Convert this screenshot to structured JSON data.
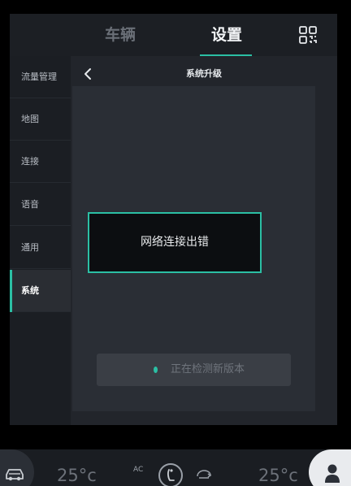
{
  "tabs": {
    "vehicle": "车辆",
    "settings": "设置"
  },
  "sidebar": {
    "items": [
      {
        "label": "流量管理",
        "active": false
      },
      {
        "label": "地图",
        "active": false
      },
      {
        "label": "连接",
        "active": false
      },
      {
        "label": "语音",
        "active": false
      },
      {
        "label": "通用",
        "active": false
      },
      {
        "label": "系统",
        "active": true
      }
    ]
  },
  "content": {
    "title": "系统升级",
    "check_button": "正在检测新版本"
  },
  "toast": {
    "message": "网络连接出错"
  },
  "dock": {
    "left_temp": "25°c",
    "right_temp": "25°c",
    "ac_label": "AC"
  },
  "colors": {
    "accent": "#2bbfa4",
    "background": "#22252b",
    "sidebar": "#1b1e23"
  },
  "icons": [
    "qr-code-icon",
    "back-chevron-icon",
    "car-icon",
    "seat-heat-icon",
    "recirculation-icon",
    "user-icon"
  ]
}
